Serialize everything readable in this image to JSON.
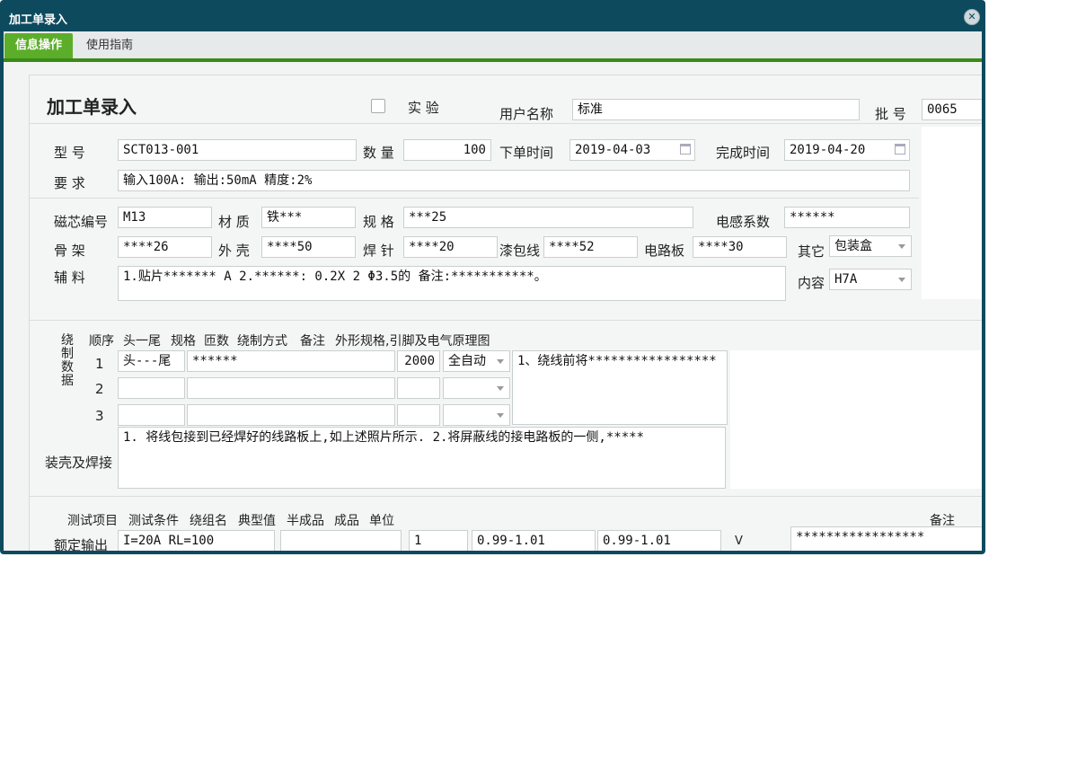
{
  "window": {
    "title": "加工单录入"
  },
  "tabs": [
    {
      "label": "信息操作"
    },
    {
      "label": "使用指南"
    }
  ],
  "header": {
    "title": "加工单录入",
    "checkbox_label": "实 验",
    "user_label": "用户名称",
    "user_value": "标准",
    "batch_label": "批 号",
    "batch_value": "0065"
  },
  "order": {
    "model_label": "型 号",
    "model_value": "SCT013-001",
    "qty_label": "数 量",
    "qty_value": "100",
    "order_time_label": "下单时间",
    "order_time_value": "2019-04-03",
    "finish_time_label": "完成时间",
    "finish_time_value": "2019-04-20",
    "req_label": "要 求",
    "req_value": "输入100A:  输出:50mA   精度:2%"
  },
  "material": {
    "core_label": "磁芯编号",
    "core_value": "M13",
    "mat_label": "材 质",
    "mat_value": "铁***",
    "spec_label": "规 格",
    "spec_value": "***25",
    "induct_label": "电感系数",
    "induct_value": "******",
    "frame_label": "骨 架",
    "frame_value": "****26",
    "shell_label": "外 壳",
    "shell_value": "****50",
    "pin_label": "焊 针",
    "pin_value": "****20",
    "wire_label": "漆包线",
    "wire_value": "****52",
    "pcb_label": "电路板",
    "pcb_value": "****30",
    "other_label": "其它",
    "other_value": "包装盒",
    "aux_label": "辅 料",
    "aux_value": "1.贴片******* A 2.******: 0.2X 2 Φ3.5的 备注:***********。",
    "content_label": "内容",
    "content_value": "H7A"
  },
  "winding": {
    "side_label": [
      "绕",
      "制",
      "数",
      "据"
    ],
    "headers": [
      "顺序",
      "头一尾",
      "规格",
      "匝数",
      "绕制方式",
      "备注",
      "外形规格,引脚及电气原理图"
    ],
    "rows": [
      {
        "seq": "1",
        "headtail": "头---尾",
        "spec": "******",
        "turns": "2000",
        "method": "全自动",
        "note": "1、绕线前将*****************"
      },
      {
        "seq": "2",
        "headtail": "",
        "spec": "",
        "turns": "",
        "method": ""
      },
      {
        "seq": "3",
        "headtail": "",
        "spec": "",
        "turns": "",
        "method": ""
      }
    ],
    "assembly_label": "装壳及焊接",
    "assembly_value": "1. 将线包接到已经焊好的线路板上,如上述照片所示.  2.将屏蔽线的接电路板的一侧,*****"
  },
  "test": {
    "headers": [
      "测试项目",
      "测试条件",
      "绕组名",
      "典型值",
      "半成品",
      "成品",
      "单位"
    ],
    "remark_label": "备注",
    "row": {
      "item": "额定输出",
      "condition": "I=20A  RL=100",
      "winding": "",
      "typical": "1",
      "semi": "0.99-1.01",
      "final": "0.99-1.01",
      "unit": "V",
      "remark": "*****************"
    }
  }
}
